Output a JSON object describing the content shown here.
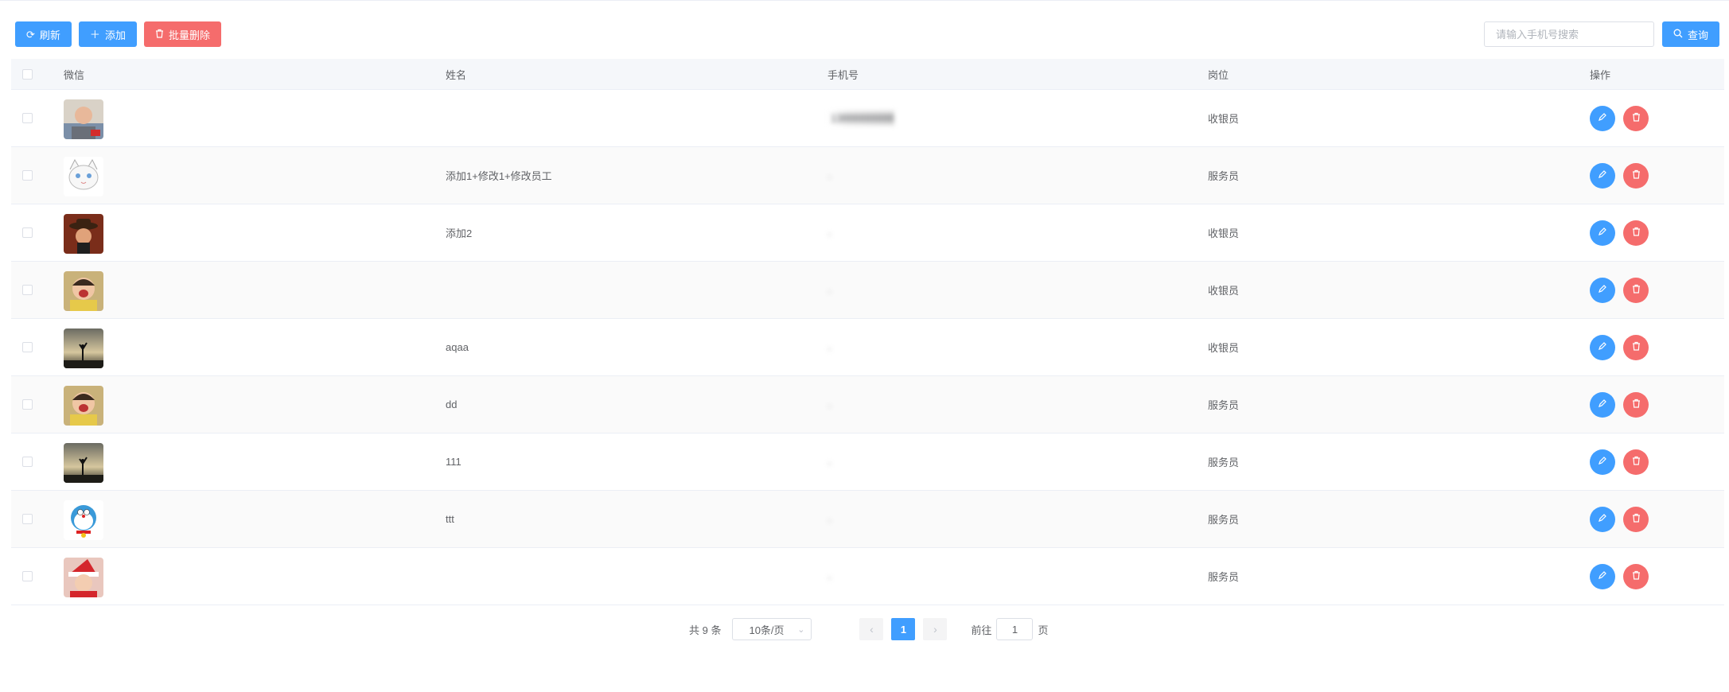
{
  "toolbar": {
    "refresh_label": "刷新",
    "add_label": "添加",
    "batch_delete_label": "批量删除"
  },
  "search": {
    "placeholder": "请输入手机号搜索",
    "button_label": "查询"
  },
  "table": {
    "columns": [
      "微信",
      "姓名",
      "手机号",
      "岗位",
      "操作"
    ],
    "rows": [
      {
        "wechat": "",
        "name": "",
        "phone": "13888888888",
        "role": "收银员",
        "avatar": "man-photo"
      },
      {
        "wechat": "",
        "name": "添加1+修改1+修改员工",
        "phone": "",
        "role": "服务员",
        "avatar": "cat-drawing"
      },
      {
        "wechat": "",
        "name": "添加2",
        "phone": "",
        "role": "收银员",
        "avatar": "cowboy-cartoon"
      },
      {
        "wechat": "",
        "name": "",
        "phone": "",
        "role": "收银员",
        "avatar": "crying-child"
      },
      {
        "wechat": "",
        "name": "aqaa",
        "phone": "",
        "role": "收银员",
        "avatar": "sunset-silhouette"
      },
      {
        "wechat": "",
        "name": "dd",
        "phone": "",
        "role": "服务员",
        "avatar": "crying-child"
      },
      {
        "wechat": "",
        "name": "111",
        "phone": "",
        "role": "服务员",
        "avatar": "sunset-silhouette"
      },
      {
        "wechat": "",
        "name": "ttt",
        "phone": "",
        "role": "服务员",
        "avatar": "doraemon"
      },
      {
        "wechat": "",
        "name": "",
        "phone": "",
        "role": "服务员",
        "avatar": "baby-santa"
      }
    ]
  },
  "pagination": {
    "total_text": "共 9 条",
    "page_size": "10条/页",
    "current_page": "1",
    "goto_prefix": "前往",
    "goto_value": "1",
    "goto_suffix": "页"
  },
  "colors": {
    "primary": "#409eff",
    "danger": "#f56c6c"
  }
}
